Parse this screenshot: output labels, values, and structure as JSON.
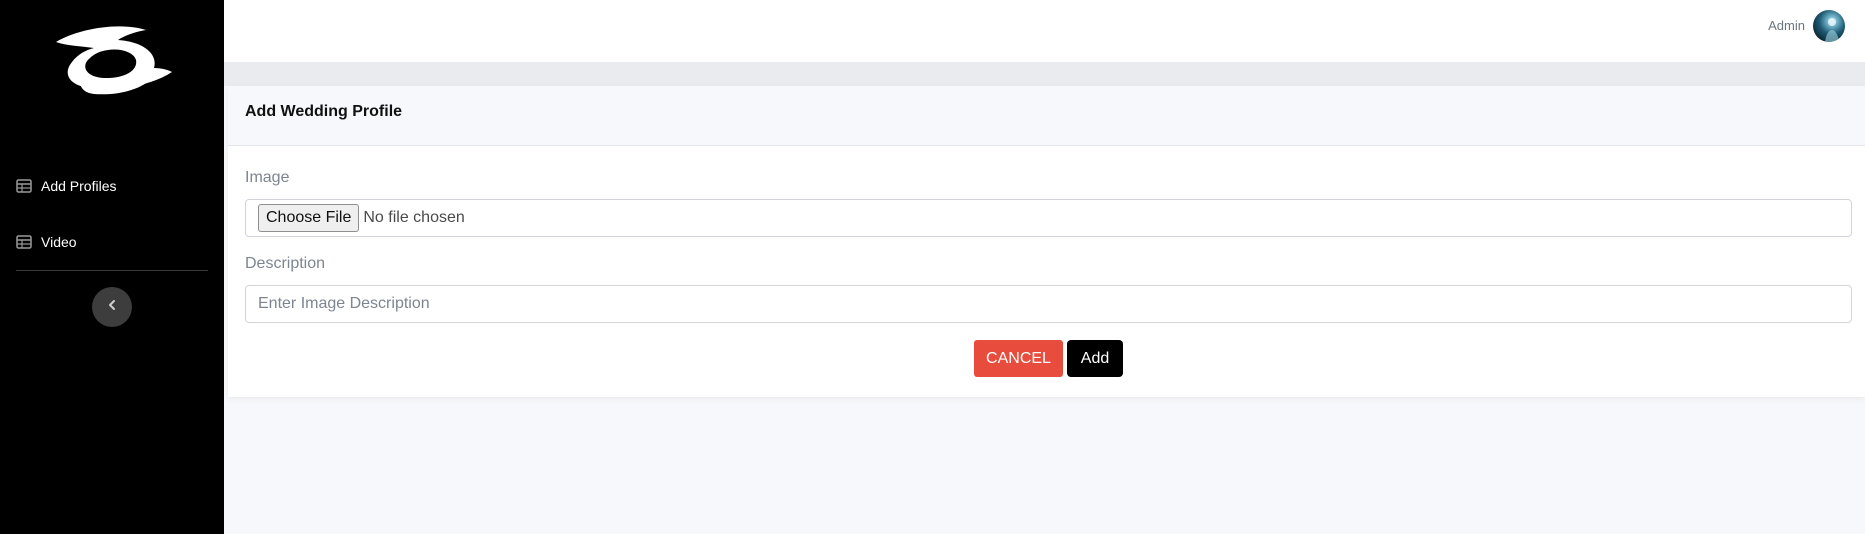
{
  "sidebar": {
    "logo_icon": "brand-logo",
    "items": [
      {
        "label": "Add Profiles",
        "icon": "table-icon"
      },
      {
        "label": "Video",
        "icon": "table-icon"
      }
    ],
    "collapse_icon": "chevron-left-icon"
  },
  "header": {
    "user_name": "Admin",
    "avatar_icon": "user-avatar"
  },
  "form": {
    "title": "Add Wedding Profile",
    "image_label": "Image",
    "file_button_label": "Choose File",
    "file_status": "No file chosen",
    "description_label": "Description",
    "description_placeholder": "Enter Image Description",
    "description_value": "",
    "cancel_label": "CANCEL",
    "add_label": "Add"
  },
  "colors": {
    "sidebar_bg": "#000000",
    "cancel_bg": "#e74c3c",
    "add_bg": "#000000",
    "page_bg": "#f7f8fb"
  }
}
